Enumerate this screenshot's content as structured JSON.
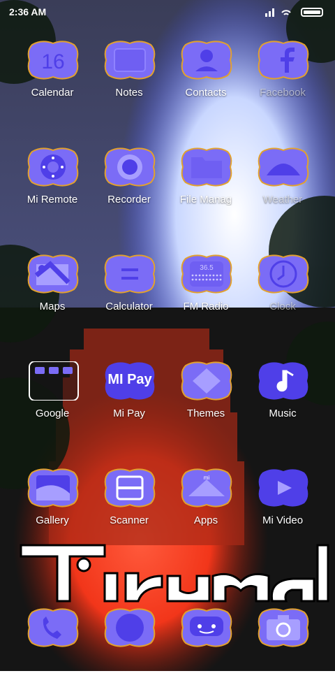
{
  "status": {
    "time": "2:36 AM"
  },
  "apps": [
    {
      "label": "Calendar",
      "icon": "calendar-icon",
      "badge": "16",
      "faded": false
    },
    {
      "label": "Notes",
      "icon": "notes-icon",
      "faded": false
    },
    {
      "label": "Contacts",
      "icon": "contacts-icon",
      "faded": false
    },
    {
      "label": "Facebook",
      "icon": "facebook-icon",
      "faded": true
    },
    {
      "label": "Mi Remote",
      "icon": "remote-icon",
      "faded": false
    },
    {
      "label": "Recorder",
      "icon": "recorder-icon",
      "faded": false
    },
    {
      "label": "File Manag",
      "icon": "folder-icon",
      "faded": false
    },
    {
      "label": "Weather",
      "icon": "weather-icon",
      "faded": true
    },
    {
      "label": "Maps",
      "icon": "maps-icon",
      "faded": false
    },
    {
      "label": "Calculator",
      "icon": "calculator-icon",
      "faded": false
    },
    {
      "label": "FM Radio",
      "icon": "radio-icon",
      "badge": "36.5",
      "faded": false
    },
    {
      "label": "Clock",
      "icon": "clock-icon",
      "faded": true
    },
    {
      "label": "Google",
      "icon": "google-folder-icon",
      "faded": false
    },
    {
      "label": "Mi Pay",
      "icon": "mi-pay-icon",
      "badge": "MI Pay",
      "faded": false
    },
    {
      "label": "Themes",
      "icon": "themes-icon",
      "faded": false
    },
    {
      "label": "Music",
      "icon": "music-icon",
      "faded": false
    },
    {
      "label": "Gallery",
      "icon": "gallery-icon",
      "faded": false
    },
    {
      "label": "Scanner",
      "icon": "scanner-icon",
      "faded": false
    },
    {
      "label": "Apps",
      "icon": "apps-icon",
      "badge": "mi",
      "faded": false
    },
    {
      "label": "Mi Video",
      "icon": "video-icon",
      "faded": false
    }
  ],
  "dock": [
    {
      "icon": "phone-icon"
    },
    {
      "icon": "browser-icon"
    },
    {
      "icon": "messages-icon"
    },
    {
      "icon": "camera-icon"
    }
  ],
  "wallpaper": {
    "caption": "Tirumala"
  },
  "colors": {
    "icon_fill": "#7b6cf6",
    "icon_border": "#e2a12e",
    "accent_deep": "#4f3fe8"
  }
}
